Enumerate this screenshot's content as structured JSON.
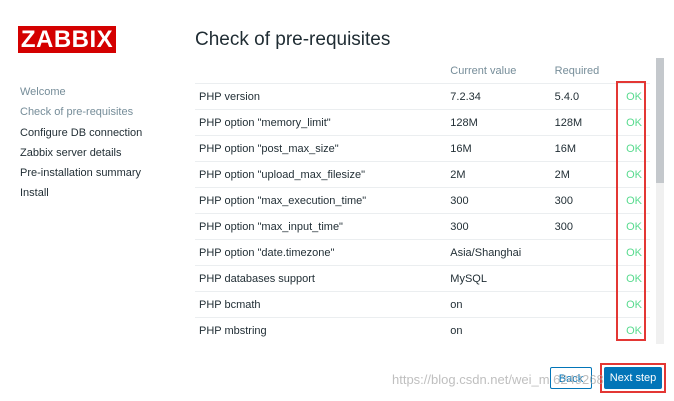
{
  "brand": {
    "logo_text": "ZABBIX",
    "color": "#d40000"
  },
  "sidebar": {
    "items": [
      {
        "label": "Welcome",
        "state": "done"
      },
      {
        "label": "Check of pre-requisites",
        "state": "done"
      },
      {
        "label": "Configure DB connection",
        "state": "pending"
      },
      {
        "label": "Zabbix server details",
        "state": "pending"
      },
      {
        "label": "Pre-installation summary",
        "state": "pending"
      },
      {
        "label": "Install",
        "state": "pending"
      }
    ]
  },
  "main": {
    "title": "Check of pre-requisites",
    "columns": [
      "",
      "Current value",
      "Required",
      ""
    ],
    "rows": [
      {
        "name": "PHP version",
        "current": "7.2.34",
        "required": "5.4.0",
        "status": "OK"
      },
      {
        "name": "PHP option \"memory_limit\"",
        "current": "128M",
        "required": "128M",
        "status": "OK"
      },
      {
        "name": "PHP option \"post_max_size\"",
        "current": "16M",
        "required": "16M",
        "status": "OK"
      },
      {
        "name": "PHP option \"upload_max_filesize\"",
        "current": "2M",
        "required": "2M",
        "status": "OK"
      },
      {
        "name": "PHP option \"max_execution_time\"",
        "current": "300",
        "required": "300",
        "status": "OK"
      },
      {
        "name": "PHP option \"max_input_time\"",
        "current": "300",
        "required": "300",
        "status": "OK"
      },
      {
        "name": "PHP option \"date.timezone\"",
        "current": "Asia/Shanghai",
        "required": "",
        "status": "OK"
      },
      {
        "name": "PHP databases support",
        "current": "MySQL",
        "required": "",
        "status": "OK"
      },
      {
        "name": "PHP bcmath",
        "current": "on",
        "required": "",
        "status": "OK"
      },
      {
        "name": "PHP mbstring",
        "current": "on",
        "required": "",
        "status": "OK"
      }
    ]
  },
  "footer": {
    "back_label": "Back",
    "next_label": "Next step"
  },
  "watermark": "https://blog.csdn.net/wei_m 6249268",
  "colors": {
    "ok": "#59db8f",
    "accent": "#0275b8",
    "annotation": "#e33734"
  }
}
